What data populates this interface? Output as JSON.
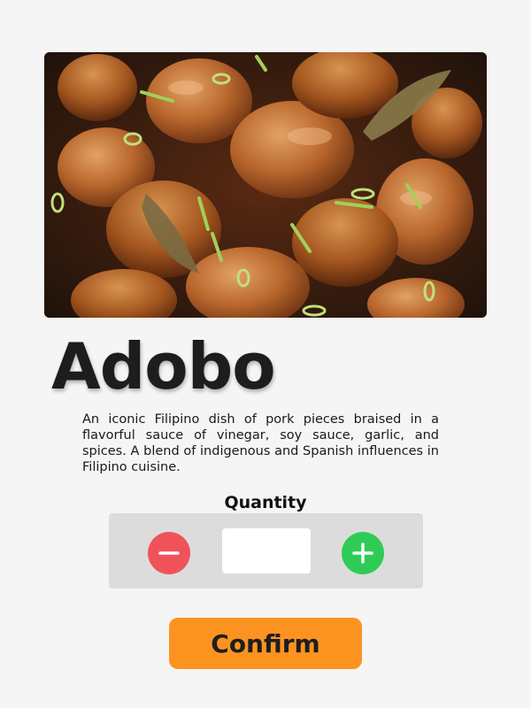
{
  "dish": {
    "image_alt": "Adobo chicken dish",
    "title": "Adobo",
    "description": "An iconic Filipino dish of pork pieces braised in a flavorful sauce of vinegar, soy sauce, garlic, and spices. A blend of indigenous and Spanish influences in Filipino cuisine."
  },
  "quantity": {
    "label": "Quantity",
    "value": "",
    "minus_icon": "minus-icon",
    "plus_icon": "plus-icon"
  },
  "actions": {
    "confirm_label": "Confirm"
  },
  "colors": {
    "background": "#f5f5f5",
    "minus": "#f0525a",
    "plus": "#2ecc57",
    "confirm": "#fc9321",
    "stepper_panel": "#dcdcdc"
  }
}
